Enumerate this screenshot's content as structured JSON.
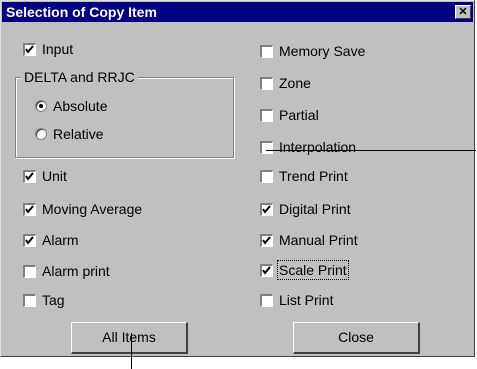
{
  "dialog": {
    "title": "Selection of Copy Item",
    "close_glyph": "✕"
  },
  "left": {
    "input": {
      "label": "Input",
      "checked": true
    },
    "group": {
      "title": "DELTA and RRJC",
      "options": [
        {
          "label": "Absolute",
          "selected": true
        },
        {
          "label": "Relative",
          "selected": false
        }
      ]
    },
    "items": [
      {
        "label": "Unit",
        "checked": true
      },
      {
        "label": "Moving Average",
        "checked": true
      },
      {
        "label": "Alarm",
        "checked": true
      },
      {
        "label": "Alarm print",
        "checked": false
      },
      {
        "label": "Tag",
        "checked": false
      }
    ]
  },
  "right": {
    "items": [
      {
        "label": "Memory Save",
        "checked": false
      },
      {
        "label": "Zone",
        "checked": false
      },
      {
        "label": "Partial",
        "checked": false
      },
      {
        "label": "Interpolation",
        "checked": false
      },
      {
        "label": "Trend Print",
        "checked": false
      },
      {
        "label": "Digital Print",
        "checked": true
      },
      {
        "label": "Manual Print",
        "checked": true
      },
      {
        "label": "Scale Print",
        "checked": true
      },
      {
        "label": "List Print",
        "checked": false
      }
    ]
  },
  "buttons": {
    "all_items": "All Items",
    "close": "Close"
  }
}
